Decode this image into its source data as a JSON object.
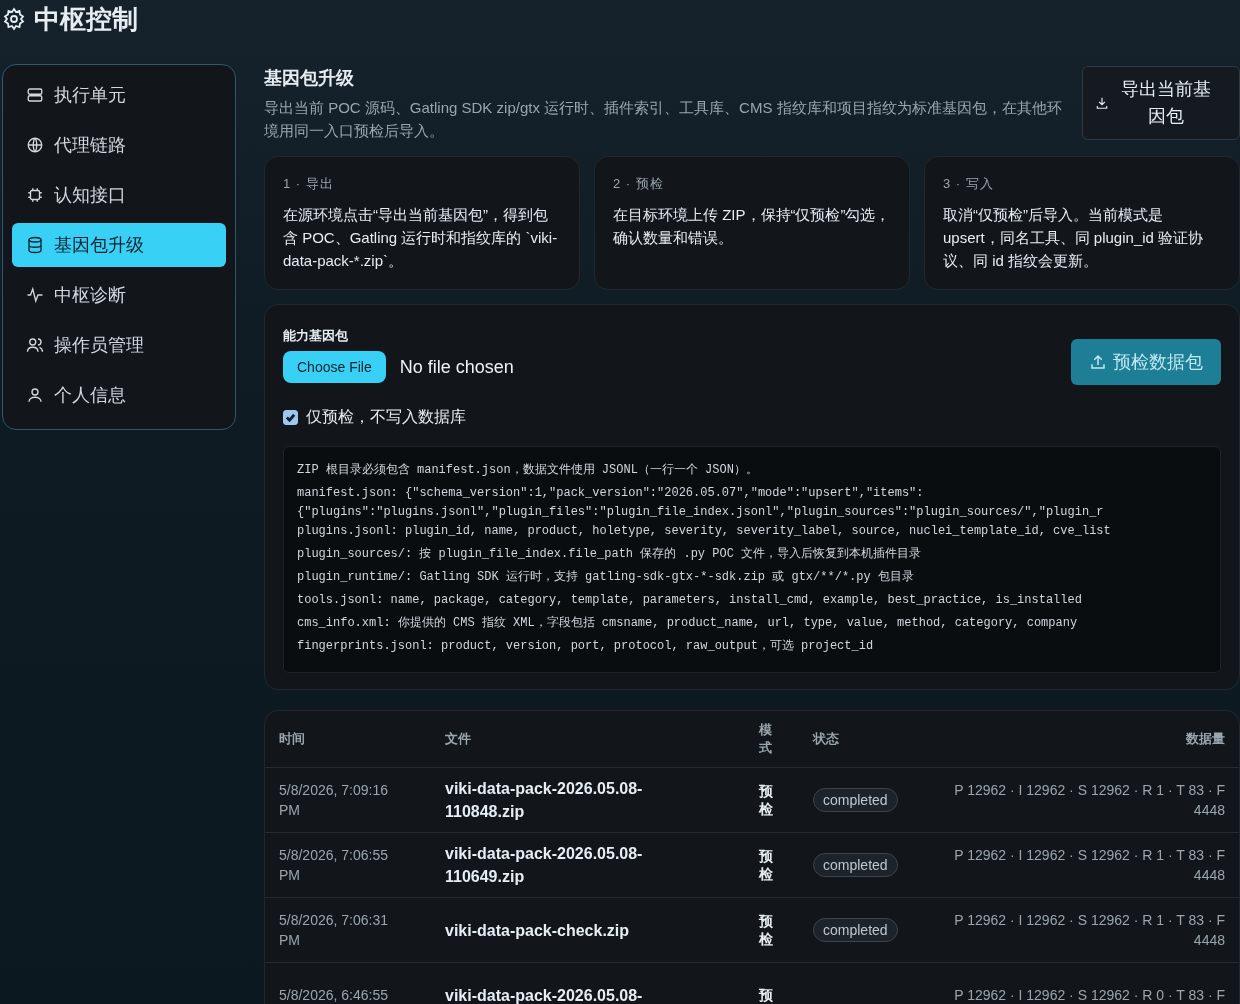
{
  "header": {
    "title": "中枢控制"
  },
  "sidebar": {
    "items": [
      {
        "label": "执行单元",
        "selected": false
      },
      {
        "label": "代理链路",
        "selected": false
      },
      {
        "label": "认知接口",
        "selected": false
      },
      {
        "label": "基因包升级",
        "selected": true
      },
      {
        "label": "中枢诊断",
        "selected": false
      },
      {
        "label": "操作员管理",
        "selected": false
      },
      {
        "label": "个人信息",
        "selected": false
      }
    ]
  },
  "section": {
    "title": "基因包升级",
    "description": "导出当前 POC 源码、Gatling SDK zip/gtx 运行时、插件索引、工具库、CMS 指纹库和项目指纹为标准基因包，在其他环境用同一入口预检后导入。",
    "export_button": "导出当前基因包"
  },
  "steps": [
    {
      "label": "1 · 导出",
      "text": "在源环境点击“导出当前基因包”，得到包含 POC、Gatling 运行时和指纹库的 `viki-data-pack-*.zip`。"
    },
    {
      "label": "2 · 预检",
      "text": "在目标环境上传 ZIP，保持“仅预检”勾选，确认数量和错误。"
    },
    {
      "label": "3 · 写入",
      "text": "取消“仅预检”后导入。当前模式是 upsert，同名工具、同 plugin_id 验证协议、同 id 指纹会更新。"
    }
  ],
  "upload": {
    "label": "能力基因包",
    "file_button": "Choose File",
    "file_status": "No file chosen",
    "submit_button": "预检数据包",
    "dry_run": {
      "label": "仅预检，不写入数据库",
      "checked": true
    },
    "spec_lines": [
      "ZIP 根目录必须包含 manifest.json，数据文件使用 JSONL（一行一个 JSON）。",
      "manifest.json: {\"schema_version\":1,\"pack_version\":\"2026.05.07\",\"mode\":\"upsert\",\"items\":",
      "{\"plugins\":\"plugins.jsonl\",\"plugin_files\":\"plugin_file_index.jsonl\",\"plugin_sources\":\"plugin_sources/\",\"plugin_r",
      "plugins.jsonl: plugin_id, name, product, holetype, severity, severity_label, source, nuclei_template_id, cve_list",
      "plugin_sources/: 按 plugin_file_index.file_path 保存的 .py POC 文件，导入后恢复到本机插件目录",
      "plugin_runtime/: Gatling SDK 运行时，支持 gatling-sdk-gtx-*-sdk.zip 或 gtx/**/*.py 包目录",
      "tools.jsonl: name, package, category, template, parameters, install_cmd, example, best_practice, is_installed",
      "cms_info.xml: 你提供的 CMS 指纹 XML，字段包括 cmsname, product_name, url, type, value, method, category, company",
      "fingerprints.jsonl: product, version, port, protocol, raw_output，可选 project_id"
    ]
  },
  "table": {
    "columns": [
      "时间",
      "文件",
      "模式",
      "状态",
      "数据量"
    ],
    "rows": [
      {
        "time": "5/8/2026, 7:09:16 PM",
        "file": "viki-data-pack-2026.05.08-110848.zip",
        "mode": "预检",
        "status": "completed",
        "counts": "P 12962 · I 12962 · S 12962 · R 1 · T 83 · F 4448"
      },
      {
        "time": "5/8/2026, 7:06:55 PM",
        "file": "viki-data-pack-2026.05.08-110649.zip",
        "mode": "预检",
        "status": "completed",
        "counts": "P 12962 · I 12962 · S 12962 · R 1 · T 83 · F 4448"
      },
      {
        "time": "5/8/2026, 7:06:31 PM",
        "file": "viki-data-pack-check.zip",
        "mode": "预检",
        "status": "completed",
        "counts": "P 12962 · I 12962 · S 12962 · R 1 · T 83 · F 4448"
      },
      {
        "time": "5/8/2026, 6:46:55",
        "file": "viki-data-pack-2026.05.08-",
        "mode": "预",
        "counts": "P 12962 · I 12962 · S 12962 · R 0 · T 83 · F"
      }
    ]
  }
}
